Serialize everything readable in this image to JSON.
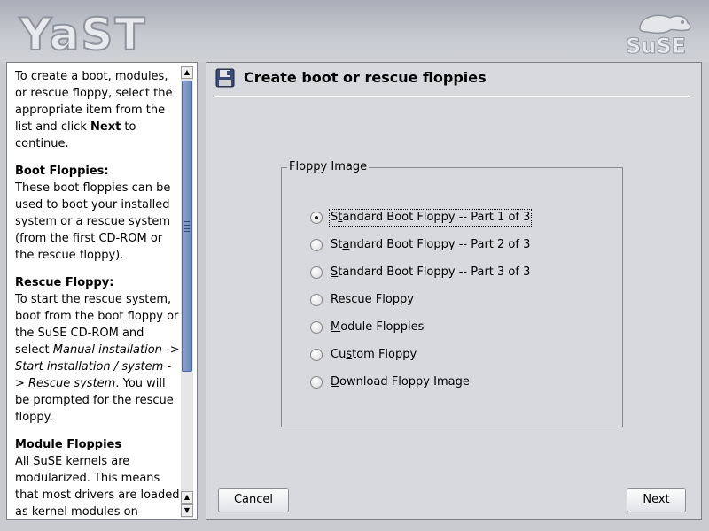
{
  "header": {
    "app_logo_text": "YaST",
    "brand_logo_text": "SuSE"
  },
  "help": {
    "intro_pre": "To create a boot, modules, or rescue floppy, select the appropriate item from the list and click ",
    "intro_bold": "Next",
    "intro_post": " to continue.",
    "boot_heading": "Boot Floppies:",
    "boot_text": "These boot floppies can be used to boot your installed system or a rescue system (from the first CD-ROM or the rescue floppy).",
    "rescue_heading": "Rescue Floppy:",
    "rescue_text_pre": "To start the rescue system, boot from the boot floppy or the SuSE CD-ROM and select ",
    "rescue_italic": "Manual installation -> Start installation / system -> Rescue system",
    "rescue_text_post": ". You will be prompted for the rescue floppy.",
    "module_heading": "Module Floppies",
    "module_text": "All SuSE kernels are modularized. This means that most drivers are loaded as kernel modules on demand. Because the space on one"
  },
  "main": {
    "title": "Create boot or rescue floppies",
    "group_title": "Floppy Image",
    "options": [
      {
        "pre": "S",
        "key": "t",
        "post": "andard Boot Floppy -- Part 1 of 3",
        "checked": true
      },
      {
        "pre": "St",
        "key": "a",
        "post": "ndard Boot Floppy -- Part 2 of 3",
        "checked": false
      },
      {
        "pre": "",
        "key": "S",
        "post": "tandard Boot Floppy -- Part 3 of 3",
        "checked": false
      },
      {
        "pre": "R",
        "key": "e",
        "post": "scue Floppy",
        "checked": false
      },
      {
        "pre": "",
        "key": "M",
        "post": "odule Floppies",
        "checked": false
      },
      {
        "pre": "Cu",
        "key": "s",
        "post": "tom Floppy",
        "checked": false
      },
      {
        "pre": "",
        "key": "D",
        "post": "ownload Floppy Image",
        "checked": false
      }
    ]
  },
  "buttons": {
    "cancel_key": "C",
    "cancel_rest": "ancel",
    "next_key": "N",
    "next_rest": "ext"
  }
}
